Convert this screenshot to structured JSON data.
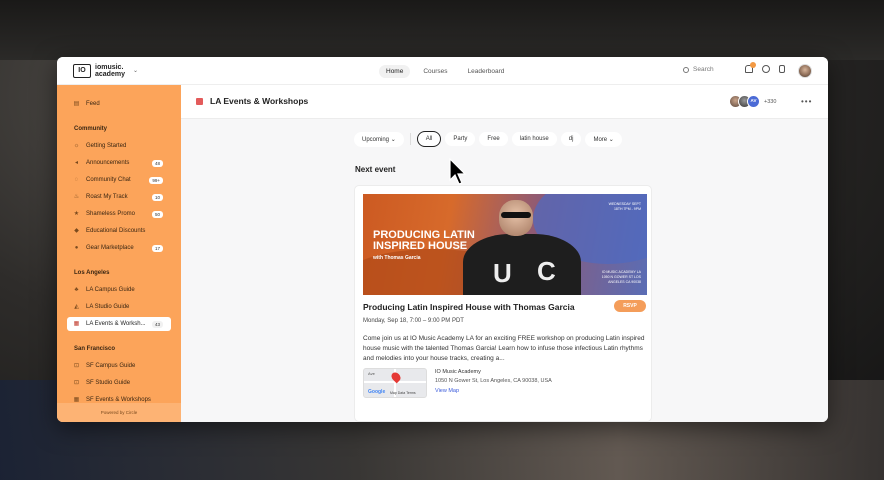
{
  "brand": {
    "logo_text": "IO",
    "name": "iomusic. academy"
  },
  "topnav": {
    "items": [
      {
        "label": "Home",
        "active": true
      },
      {
        "label": "Courses",
        "active": false
      },
      {
        "label": "Leaderboard",
        "active": false
      }
    ]
  },
  "search": {
    "label": "Search"
  },
  "sidebar": {
    "feed": "Feed",
    "sections": [
      {
        "title": "Community",
        "items": [
          {
            "label": "Getting Started",
            "icon": "rocket-icon",
            "count": ""
          },
          {
            "label": "Announcements",
            "icon": "megaphone-icon",
            "count": "48"
          },
          {
            "label": "Community Chat",
            "icon": "chat-icon",
            "count": "99+"
          },
          {
            "label": "Roast My Track",
            "icon": "fire-icon",
            "count": "10"
          },
          {
            "label": "Shameless Promo",
            "icon": "star-icon",
            "count": "50"
          },
          {
            "label": "Educational Discounts",
            "icon": "tag-icon",
            "count": ""
          },
          {
            "label": "Gear Marketplace",
            "icon": "globe-icon",
            "count": "17"
          }
        ]
      },
      {
        "title": "Los Angeles",
        "items": [
          {
            "label": "LA Campus Guide",
            "icon": "palm-icon",
            "count": ""
          },
          {
            "label": "LA Studio Guide",
            "icon": "studio-icon",
            "count": ""
          },
          {
            "label": "LA Events & Worksh...",
            "icon": "calendar-icon",
            "count": "43",
            "active": true
          }
        ]
      },
      {
        "title": "San Francisco",
        "items": [
          {
            "label": "SF Campus Guide",
            "icon": "lock-icon",
            "count": ""
          },
          {
            "label": "SF Studio Guide",
            "icon": "lock-icon",
            "count": ""
          },
          {
            "label": "SF Events & Workshops",
            "icon": "calendar-icon",
            "count": ""
          }
        ]
      }
    ],
    "powered_by": "Powered by Circle"
  },
  "header": {
    "title": "LA Events & Workshops",
    "member_initials": "AV",
    "member_count": "+330",
    "more": "•••"
  },
  "filters": {
    "sort": "Upcoming",
    "chips": [
      {
        "label": "All",
        "active": true
      },
      {
        "label": "Party",
        "active": false
      },
      {
        "label": "Free",
        "active": false
      },
      {
        "label": "latin house",
        "active": false
      },
      {
        "label": "dj",
        "active": false
      },
      {
        "label": "More",
        "active": false
      }
    ]
  },
  "next_event": {
    "section_label": "Next event",
    "banner": {
      "title": "PRODUCING LATIN INSPIRED HOUSE",
      "subtitle": "with Thomas Garcia",
      "date": "WEDNESDAY SEPT 18TH 7PM - 9PM",
      "location": "IO MUSIC ACADEMY LA 1050 N GOWER ST LOS ANGELES CA 90038"
    },
    "title": "Producing Latin Inspired House with Thomas Garcia",
    "rsvp": "RSVP",
    "datetime": "Monday, Sep 18, 7:00 – 9:00 PM PDT",
    "description": "Come join us at IO Music Academy LA for an exciting FREE workshop on producing Latin inspired house music with the talented Thomas Garcia! Learn how to infuse those infectious Latin rhythms and melodies into your house tracks, creating a...",
    "location_name": "IO Music Academy",
    "address": "1050 N Gower St, Los Angeles, CA 90038, USA",
    "view_map": "View Map",
    "map_labels": {
      "google": "Google",
      "map_data": "Map Data",
      "terms": "Terms",
      "area": "Ave"
    }
  }
}
